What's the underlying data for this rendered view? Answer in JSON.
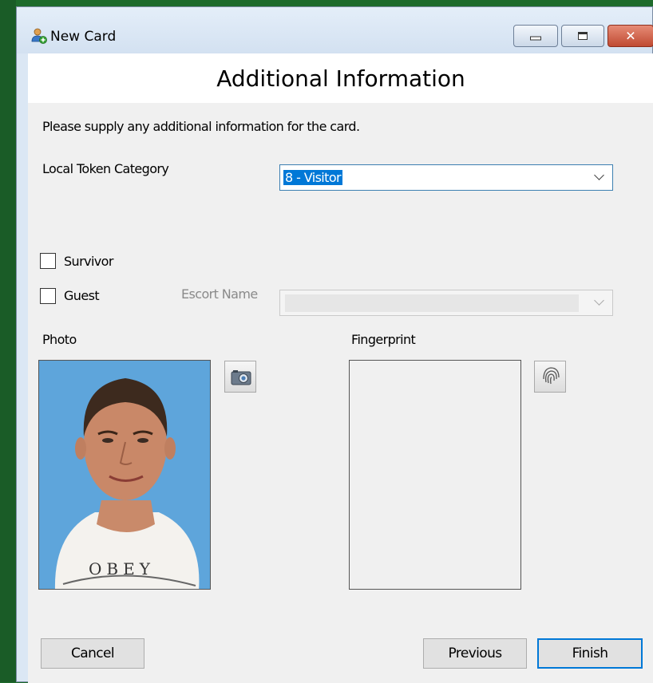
{
  "window": {
    "title": "New Card",
    "icon": "user-add-icon",
    "controls": {
      "minimize": "minimize-icon",
      "maximize": "maximize-icon",
      "close": "✕"
    }
  },
  "header": {
    "title": "Additional Information"
  },
  "instructions": "Please supply any additional information for the card.",
  "token_category": {
    "label": "Local Token Category",
    "value": "8 - Visitor"
  },
  "checkboxes": {
    "survivor": {
      "label": "Survivor",
      "checked": false
    },
    "guest": {
      "label": "Guest",
      "checked": false
    }
  },
  "escort": {
    "label": "Escort Name",
    "value": ""
  },
  "photo": {
    "label": "Photo",
    "button_icon": "camera-icon"
  },
  "fingerprint": {
    "label": "Fingerprint",
    "button_icon": "fingerprint-icon"
  },
  "buttons": {
    "cancel": "Cancel",
    "previous": "Previous",
    "finish": "Finish"
  },
  "colors": {
    "accent": "#0078d7",
    "selection": "#0078d7",
    "desktop": "#1e6b2c"
  }
}
